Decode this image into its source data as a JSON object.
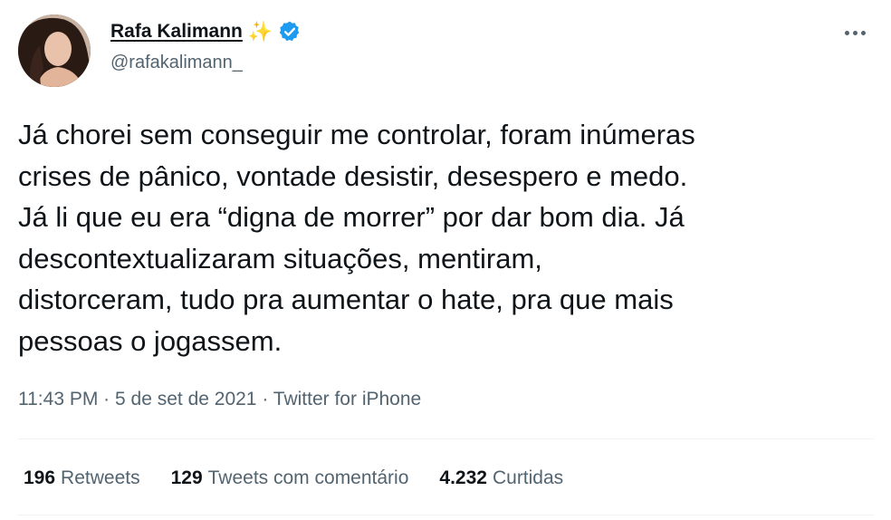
{
  "author": {
    "display_name": "Rafa Kalimann",
    "emoji": "✨",
    "handle": "@rafakalimann_",
    "verified": true
  },
  "tweet": {
    "text": "Já chorei sem conseguir me controlar, foram inúmeras\ncrises de pânico, vontade desistir, desespero e medo.\nJá li que eu era “digna de morrer” por dar bom dia. Já\ndescontextualizaram situações, mentiram,\ndistorceram, tudo pra aumentar o hate, pra que mais\npessoas o jogassem."
  },
  "meta": {
    "time": "11:43 PM",
    "date": "5 de set de 2021",
    "separator": "·",
    "source": "Twitter for iPhone"
  },
  "stats": {
    "retweets": {
      "count": "196",
      "label": "Retweets"
    },
    "quotes": {
      "count": "129",
      "label": "Tweets com comentário"
    },
    "likes": {
      "count": "4.232",
      "label": "Curtidas"
    }
  },
  "icons": {
    "more": "more-horizontal-icon",
    "verified": "verified-badge-icon"
  },
  "colors": {
    "verified_blue": "#1d9bf0",
    "text_primary": "#0f1419",
    "text_secondary": "#536471",
    "divider": "#eff3f4"
  }
}
